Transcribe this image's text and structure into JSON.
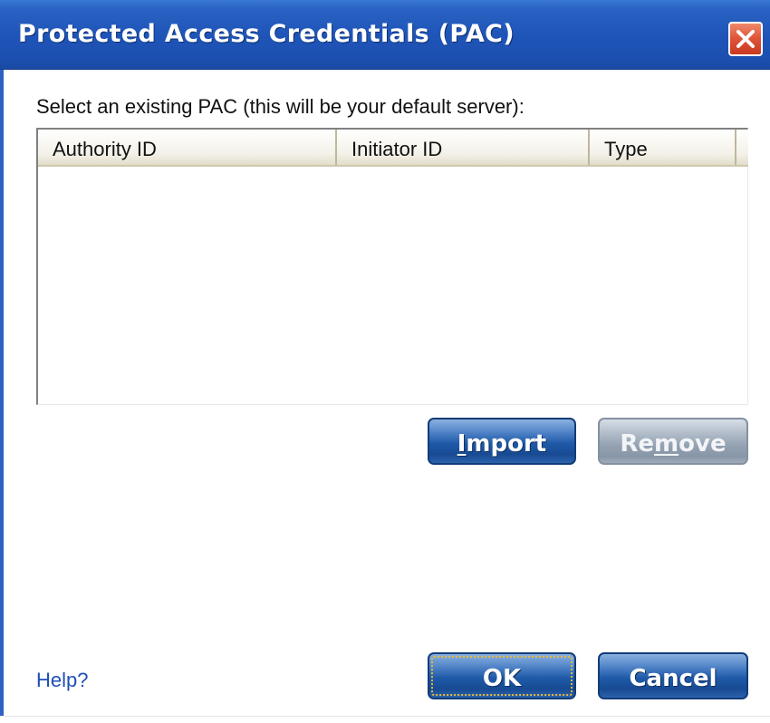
{
  "window": {
    "title": "Protected Access Credentials (PAC)",
    "close_icon": "close-icon",
    "accent_color": "#2a63c4",
    "close_color": "#e0563a"
  },
  "main": {
    "instruction": "Select an existing PAC (this will be your default server):",
    "list": {
      "columns": [
        "Authority ID",
        "Initiator ID",
        "Type"
      ],
      "rows": []
    },
    "buttons": {
      "import": {
        "prefix": "",
        "mnemonic": "I",
        "suffix": "mport",
        "enabled": true
      },
      "remove": {
        "prefix": "Re",
        "mnemonic": "m",
        "suffix": "ove",
        "enabled": false
      }
    }
  },
  "footer": {
    "help_label": "Help?",
    "ok_label": "OK",
    "cancel_label": "Cancel"
  }
}
